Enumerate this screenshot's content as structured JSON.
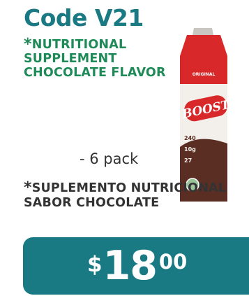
{
  "offer": {
    "code": "Code V21",
    "description_en_star": "*",
    "description_en": "NUTRITIONAL SUPPLEMENT CHOCOLATE FLAVOR",
    "pack_size": "- 6 pack",
    "description_es_star": "*",
    "description_es": "SUPLEMENTO NUTRICIONAL SABOR CHOCOLATE",
    "price": {
      "currency": "$",
      "whole": "18",
      "cents": "00"
    }
  },
  "product_image": {
    "brand": "BOOST",
    "carton_top_text": "ORIGINAL",
    "nutrition_lines": [
      "240",
      "10g",
      "27"
    ],
    "colors": {
      "carton_red": "#d8282a",
      "carton_white": "#f3efea",
      "chocolate": "#5a2e22",
      "accent_teal": "#1a7a84"
    }
  },
  "colors": {
    "title_teal": "#1a7a84",
    "desc_green": "#1e8a57",
    "text_dark": "#333333",
    "price_bg": "#1a7a84",
    "price_text": "#ffffff"
  }
}
